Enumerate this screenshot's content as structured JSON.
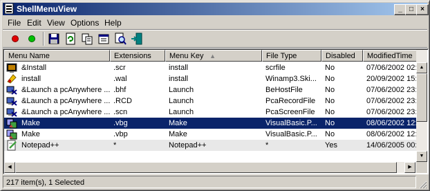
{
  "window": {
    "title": "ShellMenuView",
    "controls": {
      "minimize": "_",
      "maximize": "□",
      "close": "×"
    }
  },
  "menubar": {
    "items": [
      "File",
      "Edit",
      "View",
      "Options",
      "Help"
    ]
  },
  "toolbar": {
    "icons": [
      "red-dot-icon",
      "green-dot-icon",
      "save-icon",
      "refresh-icon",
      "copy-icon",
      "properties-icon",
      "search-icon",
      "exit-icon"
    ]
  },
  "table": {
    "columns": [
      "Menu Name",
      "Extensions",
      "Menu Key",
      "File Type",
      "Disabled",
      "ModifiedTime"
    ],
    "sorted_column": "Menu Key",
    "rows": [
      {
        "name": "&Install",
        "ext": ".scr",
        "key": "install",
        "type": "scrfile",
        "disabled": "No",
        "time": "07/06/2002 02:",
        "icon": "screensaver-icon"
      },
      {
        "name": "install",
        "ext": ".wal",
        "key": "install",
        "type": "Winamp3.Ski...",
        "disabled": "No",
        "time": "20/09/2002 15:",
        "icon": "winamp-skin-icon"
      },
      {
        "name": "&Launch a pcAnywhere ...",
        "ext": ".bhf",
        "key": "Launch",
        "type": "BeHostFile",
        "disabled": "No",
        "time": "07/06/2002 23:",
        "icon": "pcanywhere-icon"
      },
      {
        "name": "&Launch a pcAnywhere ...",
        "ext": ".RCD",
        "key": "Launch",
        "type": "PcaRecordFile",
        "disabled": "No",
        "time": "07/06/2002 23:",
        "icon": "pcanywhere-icon"
      },
      {
        "name": "&Launch a pcAnywhere ...",
        "ext": ".scn",
        "key": "Launch",
        "type": "PcaScreenFile",
        "disabled": "No",
        "time": "07/06/2002 23:",
        "icon": "pcanywhere-icon"
      },
      {
        "name": "Make",
        "ext": ".vbg",
        "key": "Make",
        "type": "VisualBasic.P...",
        "disabled": "No",
        "time": "08/06/2002 12:",
        "icon": "visualbasic-icon",
        "selected": true
      },
      {
        "name": "Make",
        "ext": ".vbp",
        "key": "Make",
        "type": "VisualBasic.P...",
        "disabled": "No",
        "time": "08/06/2002 12:",
        "icon": "visualbasic-icon"
      },
      {
        "name": "Notepad++",
        "ext": "*",
        "key": "Notepad++",
        "type": "*",
        "disabled": "Yes",
        "time": "14/06/2005 00:",
        "icon": "notepad-icon"
      }
    ]
  },
  "status": {
    "text": "217 item(s), 1 Selected"
  },
  "colors": {
    "selection": "#0a246a",
    "disabled_row": "#e8e8e8",
    "title_start": "#0a246a",
    "title_end": "#a6caf0"
  }
}
